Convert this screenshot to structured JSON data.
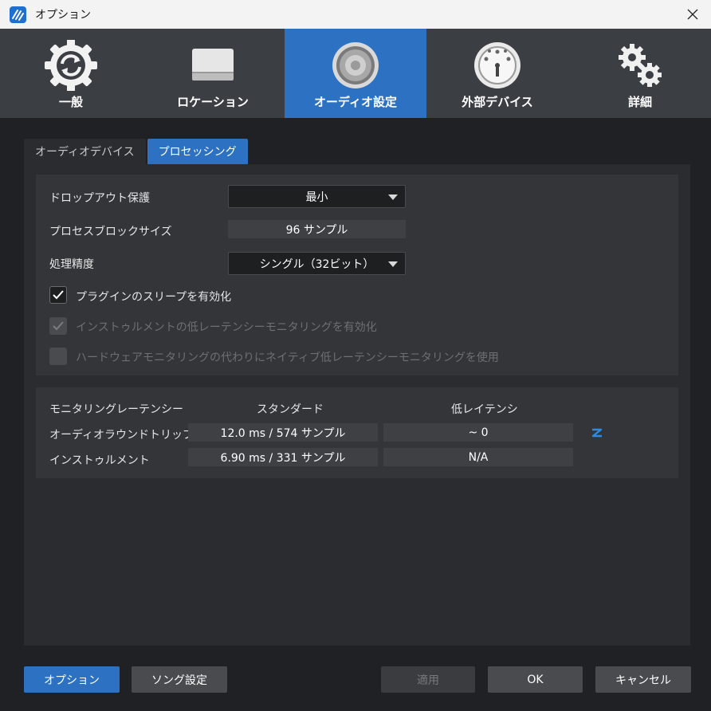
{
  "window": {
    "title": "オプション"
  },
  "categories": [
    {
      "label": "一般",
      "icon": "sync-gear-icon",
      "active": false
    },
    {
      "label": "ロケーション",
      "icon": "drive-icon",
      "active": false
    },
    {
      "label": "オーディオ設定",
      "icon": "speaker-icon",
      "active": true
    },
    {
      "label": "外部デバイス",
      "icon": "midi-port-icon",
      "active": false
    },
    {
      "label": "詳細",
      "icon": "gears-icon",
      "active": false
    }
  ],
  "subtabs": [
    {
      "label": "オーディオデバイス",
      "active": false
    },
    {
      "label": "プロセッシング",
      "active": true
    }
  ],
  "processing": {
    "dropout_label": "ドロップアウト保護",
    "dropout_value": "最小",
    "block_label": "プロセスブロックサイズ",
    "block_value": "96 サンプル",
    "precision_label": "処理精度",
    "precision_value": "シングル（32ビット）",
    "checkboxes": [
      {
        "label": "プラグインのスリープを有効化",
        "checked": true,
        "enabled": true
      },
      {
        "label": "インストゥルメントの低レーテンシーモニタリングを有効化",
        "checked": true,
        "enabled": false
      },
      {
        "label": "ハードウェアモニタリングの代わりにネイティブ低レーテンシーモニタリングを使用",
        "checked": false,
        "enabled": false
      }
    ]
  },
  "latency": {
    "header": "モニタリングレーテンシー",
    "col_standard": "スタンダード",
    "col_low": "低レイテンシ",
    "rows": [
      {
        "label": "オーディオラウンドトリップ",
        "standard": "12.0 ms / 574 サンプル",
        "low": "~ 0",
        "icon": "z-latency-icon"
      },
      {
        "label": "インストゥルメント",
        "standard": "6.90 ms / 331 サンプル",
        "low": "N/A"
      }
    ]
  },
  "footer": {
    "options": "オプション",
    "song_settings": "ソング設定",
    "apply": "適用",
    "ok": "OK",
    "cancel": "キャンセル"
  },
  "colors": {
    "accent": "#2d72c2",
    "z_icon": "#2e8be0"
  }
}
